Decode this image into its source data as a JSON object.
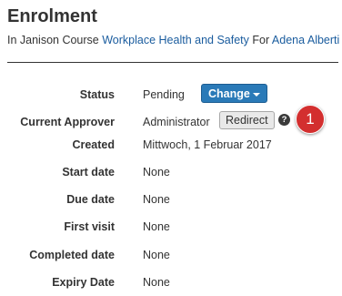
{
  "header": {
    "title": "Enrolment",
    "subtitle": {
      "prefix": "In Janison Course ",
      "course_link": "Workplace Health and Safety",
      "middle": " For ",
      "user_link": "Adena Alberti"
    }
  },
  "details": {
    "status": {
      "label": "Status",
      "value": "Pending",
      "change_button": "Change"
    },
    "approver": {
      "label": "Current Approver",
      "value": "Administrator",
      "redirect_button": "Redirect",
      "help_icon": "?"
    },
    "created": {
      "label": "Created",
      "value": "Mittwoch, 1 Februar 2017"
    },
    "start_date": {
      "label": "Start date",
      "value": "None"
    },
    "due_date": {
      "label": "Due date",
      "value": "None"
    },
    "first_visit": {
      "label": "First visit",
      "value": "None"
    },
    "completed_date": {
      "label": "Completed date",
      "value": "None"
    },
    "expiry_date": {
      "label": "Expiry Date",
      "value": "None"
    }
  },
  "annotation": {
    "badge_number": "1"
  },
  "colors": {
    "primary_button": "#2a7ab8",
    "link": "#1a5c9e",
    "badge": "#d32f2f"
  }
}
